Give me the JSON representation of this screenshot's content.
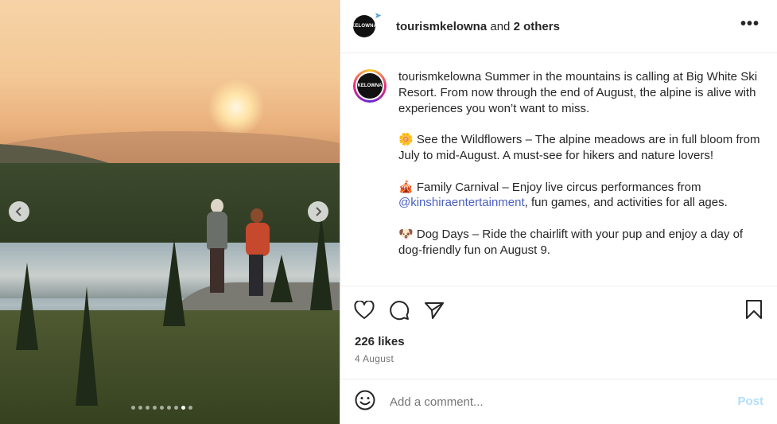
{
  "post": {
    "author": "tourismkelowna",
    "collab_connector": "and",
    "collab_others": "2 others",
    "logo_text": "KELOWNA",
    "more_icon": "more-horizontal-icon",
    "caption": {
      "username": "tourismkelowna",
      "intro": "Summer in the mountains is calling at Big White Ski Resort. From now through the end of August, the alpine is alive with experiences you won’t want to miss.",
      "p1_emoji": "🌼",
      "p1_text": "See the Wildflowers – The alpine meadows are in full bloom from July to mid-August. A must-see for hikers and nature lovers!",
      "p2_emoji": "🎪",
      "p2_text_a": "Family Carnival – Enjoy live circus performances from",
      "p2_mention": "@kinshiraentertainment",
      "p2_text_b": ", fun games, and activities for all ages.",
      "p3_emoji": "🐶",
      "p3_text": "Dog Days – Ride the chairlift with your pup and enjoy a day of dog-friendly fun on August 9."
    },
    "likes": "226 likes",
    "date": "4 August"
  },
  "carousel": {
    "dot_count": 9,
    "active_index": 7,
    "prev_icon": "chevron-left-icon",
    "next_icon": "chevron-right-icon"
  },
  "actions": {
    "like_icon": "heart-icon",
    "comment_icon": "comment-icon",
    "share_icon": "send-icon",
    "save_icon": "bookmark-icon"
  },
  "comment": {
    "placeholder": "Add a comment...",
    "post_label": "Post",
    "emoji_icon": "smiley-icon"
  },
  "colors": {
    "mention": "#4a5fc1",
    "post_disabled": "#b2dffc",
    "muted": "#737373"
  }
}
